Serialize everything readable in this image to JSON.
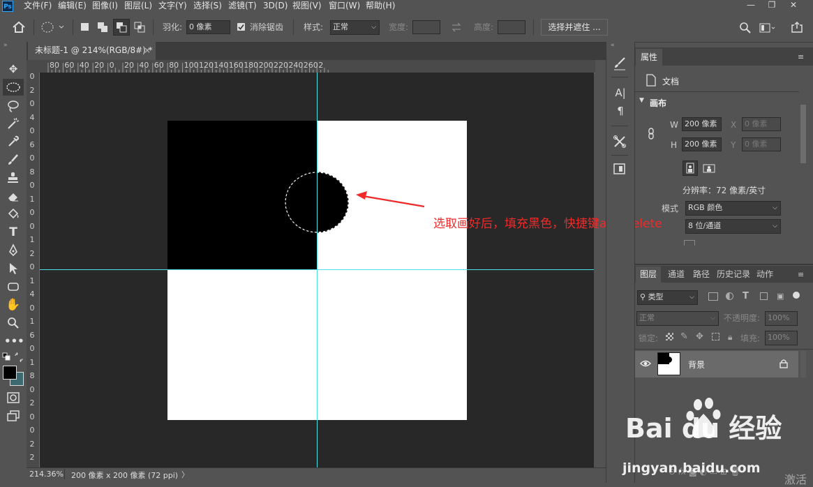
{
  "app": {
    "logo": "Ps"
  },
  "menubar": {
    "items": [
      "文件(F)",
      "编辑(E)",
      "图像(I)",
      "图层(L)",
      "文字(Y)",
      "选择(S)",
      "滤镜(T)",
      "3D(D)",
      "视图(V)",
      "窗口(W)",
      "帮助(H)"
    ]
  },
  "window_controls": {
    "minimize": "—",
    "restore": "❐",
    "close": "✕"
  },
  "options": {
    "feather_label": "羽化:",
    "feather_value": "0 像素",
    "antialias_label": "消除锯齿",
    "style_label": "样式:",
    "style_value": "正常",
    "width_label": "宽度:",
    "height_label": "高度:",
    "select_mask_button": "选择并遮住 ..."
  },
  "document": {
    "tab_title": "未标题-1 @ 214%(RGB/8#) *",
    "close": "×"
  },
  "ruler": {
    "top_ticks": [
      "80",
      "60",
      "40",
      "20",
      "0",
      "20",
      "40",
      "60",
      "80",
      "100",
      "120",
      "140",
      "160",
      "180",
      "200",
      "220",
      "240",
      "260",
      "2"
    ],
    "left_ticks": [
      "0",
      "2",
      "0",
      "4",
      "0",
      "6",
      "0",
      "8",
      "0",
      "1",
      "0",
      "0",
      "1",
      "2",
      "0",
      "1",
      "4",
      "0",
      "1",
      "6",
      "0",
      "1",
      "8",
      "0",
      "2",
      "0",
      "0",
      "2",
      "2"
    ]
  },
  "annotation": {
    "text": "选取画好后，填充黑色，快捷键alt+delete",
    "color": "#f02a2a"
  },
  "status": {
    "zoom": "214.36%",
    "doc_info": "200 像素 x 200 像素 (72 ppi)",
    "arrow": "〉"
  },
  "properties": {
    "tab": "属性",
    "doc_label": "文档",
    "canvas_section": "画布",
    "w_label": "W",
    "w_value": "200 像素",
    "h_label": "H",
    "h_value": "200 像素",
    "x_label": "X",
    "x_value": "0 像素",
    "y_label": "Y",
    "y_value": "0 像素",
    "resolution": "分辨率：72 像素/英寸",
    "mode_label": "模式",
    "mode_value": "RGB 颜色",
    "depth_value": "8 位/通道"
  },
  "layers": {
    "tabs": [
      "图层",
      "通道",
      "路径",
      "历史记录",
      "动作"
    ],
    "filter_kind": "类型",
    "blend_mode": "正常",
    "opacity_label": "不透明度:",
    "opacity_value": "100%",
    "lock_label": "锁定:",
    "fill_label": "填充:",
    "fill_value": "100%",
    "layer_name": "背景"
  },
  "watermark": {
    "brand": "Bai du 经验",
    "url": "jingyan.baidu.com",
    "extra": "激活"
  },
  "colors": {
    "guide": "#4ee0e8",
    "accent": "#31a8ff",
    "annotation": "#f02a2a"
  }
}
